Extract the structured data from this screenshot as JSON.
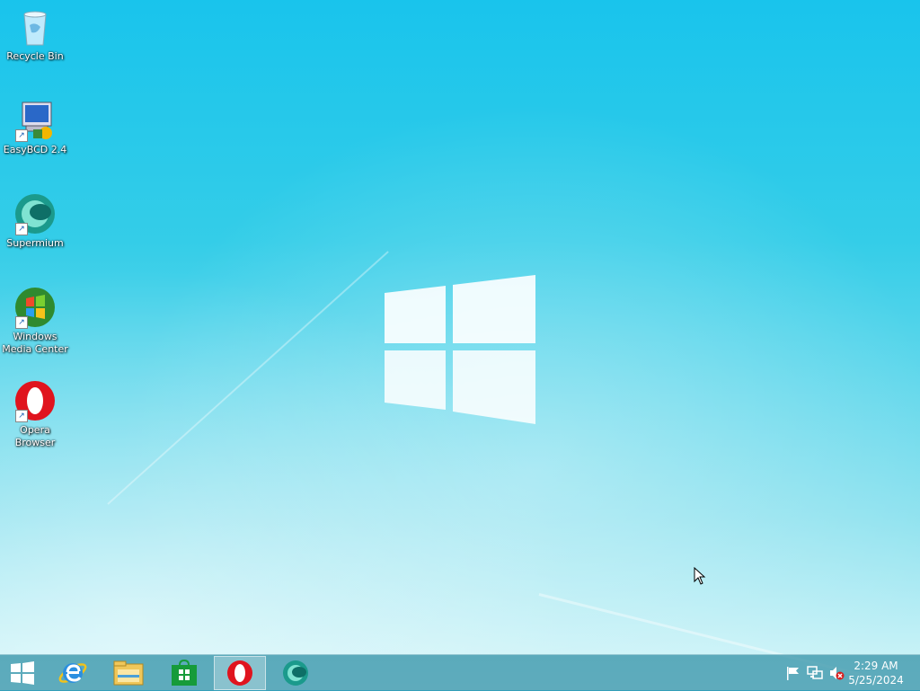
{
  "desktop": {
    "icons": [
      {
        "label": "Recycle Bin"
      },
      {
        "label": "EasyBCD 2.4"
      },
      {
        "label": "Supermium"
      },
      {
        "label": "Windows Media Center"
      },
      {
        "label": "Opera Browser"
      }
    ]
  },
  "taskbar": {
    "buttons": [
      {
        "icon": "windows-start-icon"
      },
      {
        "icon": "internet-explorer-icon"
      },
      {
        "icon": "file-explorer-icon"
      },
      {
        "icon": "windows-store-icon"
      },
      {
        "icon": "opera-icon",
        "active": true
      },
      {
        "icon": "supermium-icon"
      }
    ],
    "tray": {
      "icons": [
        "action-center-flag-icon",
        "network-icon",
        "volume-muted-icon"
      ],
      "time": "2:29 AM",
      "date": "5/25/2024"
    }
  },
  "colors": {
    "desktop_background": "#19c4ec",
    "taskbar": "#3c96aa",
    "opera_red": "#e0141e"
  }
}
